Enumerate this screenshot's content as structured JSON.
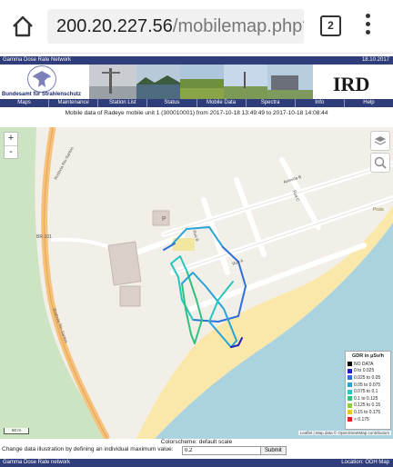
{
  "browser": {
    "url_host": "200.20.227.56",
    "url_path": "/mobilemap.php?",
    "tab_count": "2"
  },
  "page": {
    "network_name": "Gamma Dose Rate Network",
    "date": "18.10.2017",
    "bfs_name": "Bundesamt für Strahlenschutz",
    "ird_logo": "IRD",
    "nav": [
      "Maps",
      "Maintenance",
      "Station List",
      "Status",
      "Mobile Data",
      "Spectra",
      "Info",
      "Help"
    ],
    "map_title": "Mobile data of Radeye mobile unit 1 (300010001) from 2017-10-18 13:49:49 to 2017-10-18 14:08:44"
  },
  "map": {
    "road_labels": {
      "highway": "BR-101",
      "side": "Rodovia Rio-Santos",
      "avenida": "Avenida B",
      "rua": "Rua C",
      "rua_a": "Rua A",
      "rua_b": "Rua B",
      "praia": "Praia",
      "parking": "P"
    },
    "zoom_in": "+",
    "zoom_out": "-",
    "scale": "50 m",
    "attribution": "Leaflet | Map data © OpenStreetMap contributors"
  },
  "legend": {
    "title": "GDR in µSv/h",
    "items": [
      {
        "label": "NO DATA",
        "color": "#000000"
      },
      {
        "label": "0 to 0.025",
        "color": "#2020c8"
      },
      {
        "label": "0.025 to 0.05",
        "color": "#2e6fd8"
      },
      {
        "label": "0.05 to 0.075",
        "color": "#2aa3d8"
      },
      {
        "label": "0.075 to 0.1",
        "color": "#25c7c0"
      },
      {
        "label": "0.1 to 0.125",
        "color": "#30c080"
      },
      {
        "label": "0.125 to 0.15",
        "color": "#8ccf3a"
      },
      {
        "label": "0.15 to 0.175",
        "color": "#e8c82a"
      },
      {
        "label": "> 0.175",
        "color": "#e02020"
      }
    ]
  },
  "colorscheme_text": "Colorscheme: default scale",
  "change_label": "Change data illustration by defining an individual maximum value:",
  "max_input_value": "0.2",
  "submit_label": "Submit",
  "footer": {
    "left": "Gamma Dose Rate network",
    "right": "Location: ODH Map"
  }
}
